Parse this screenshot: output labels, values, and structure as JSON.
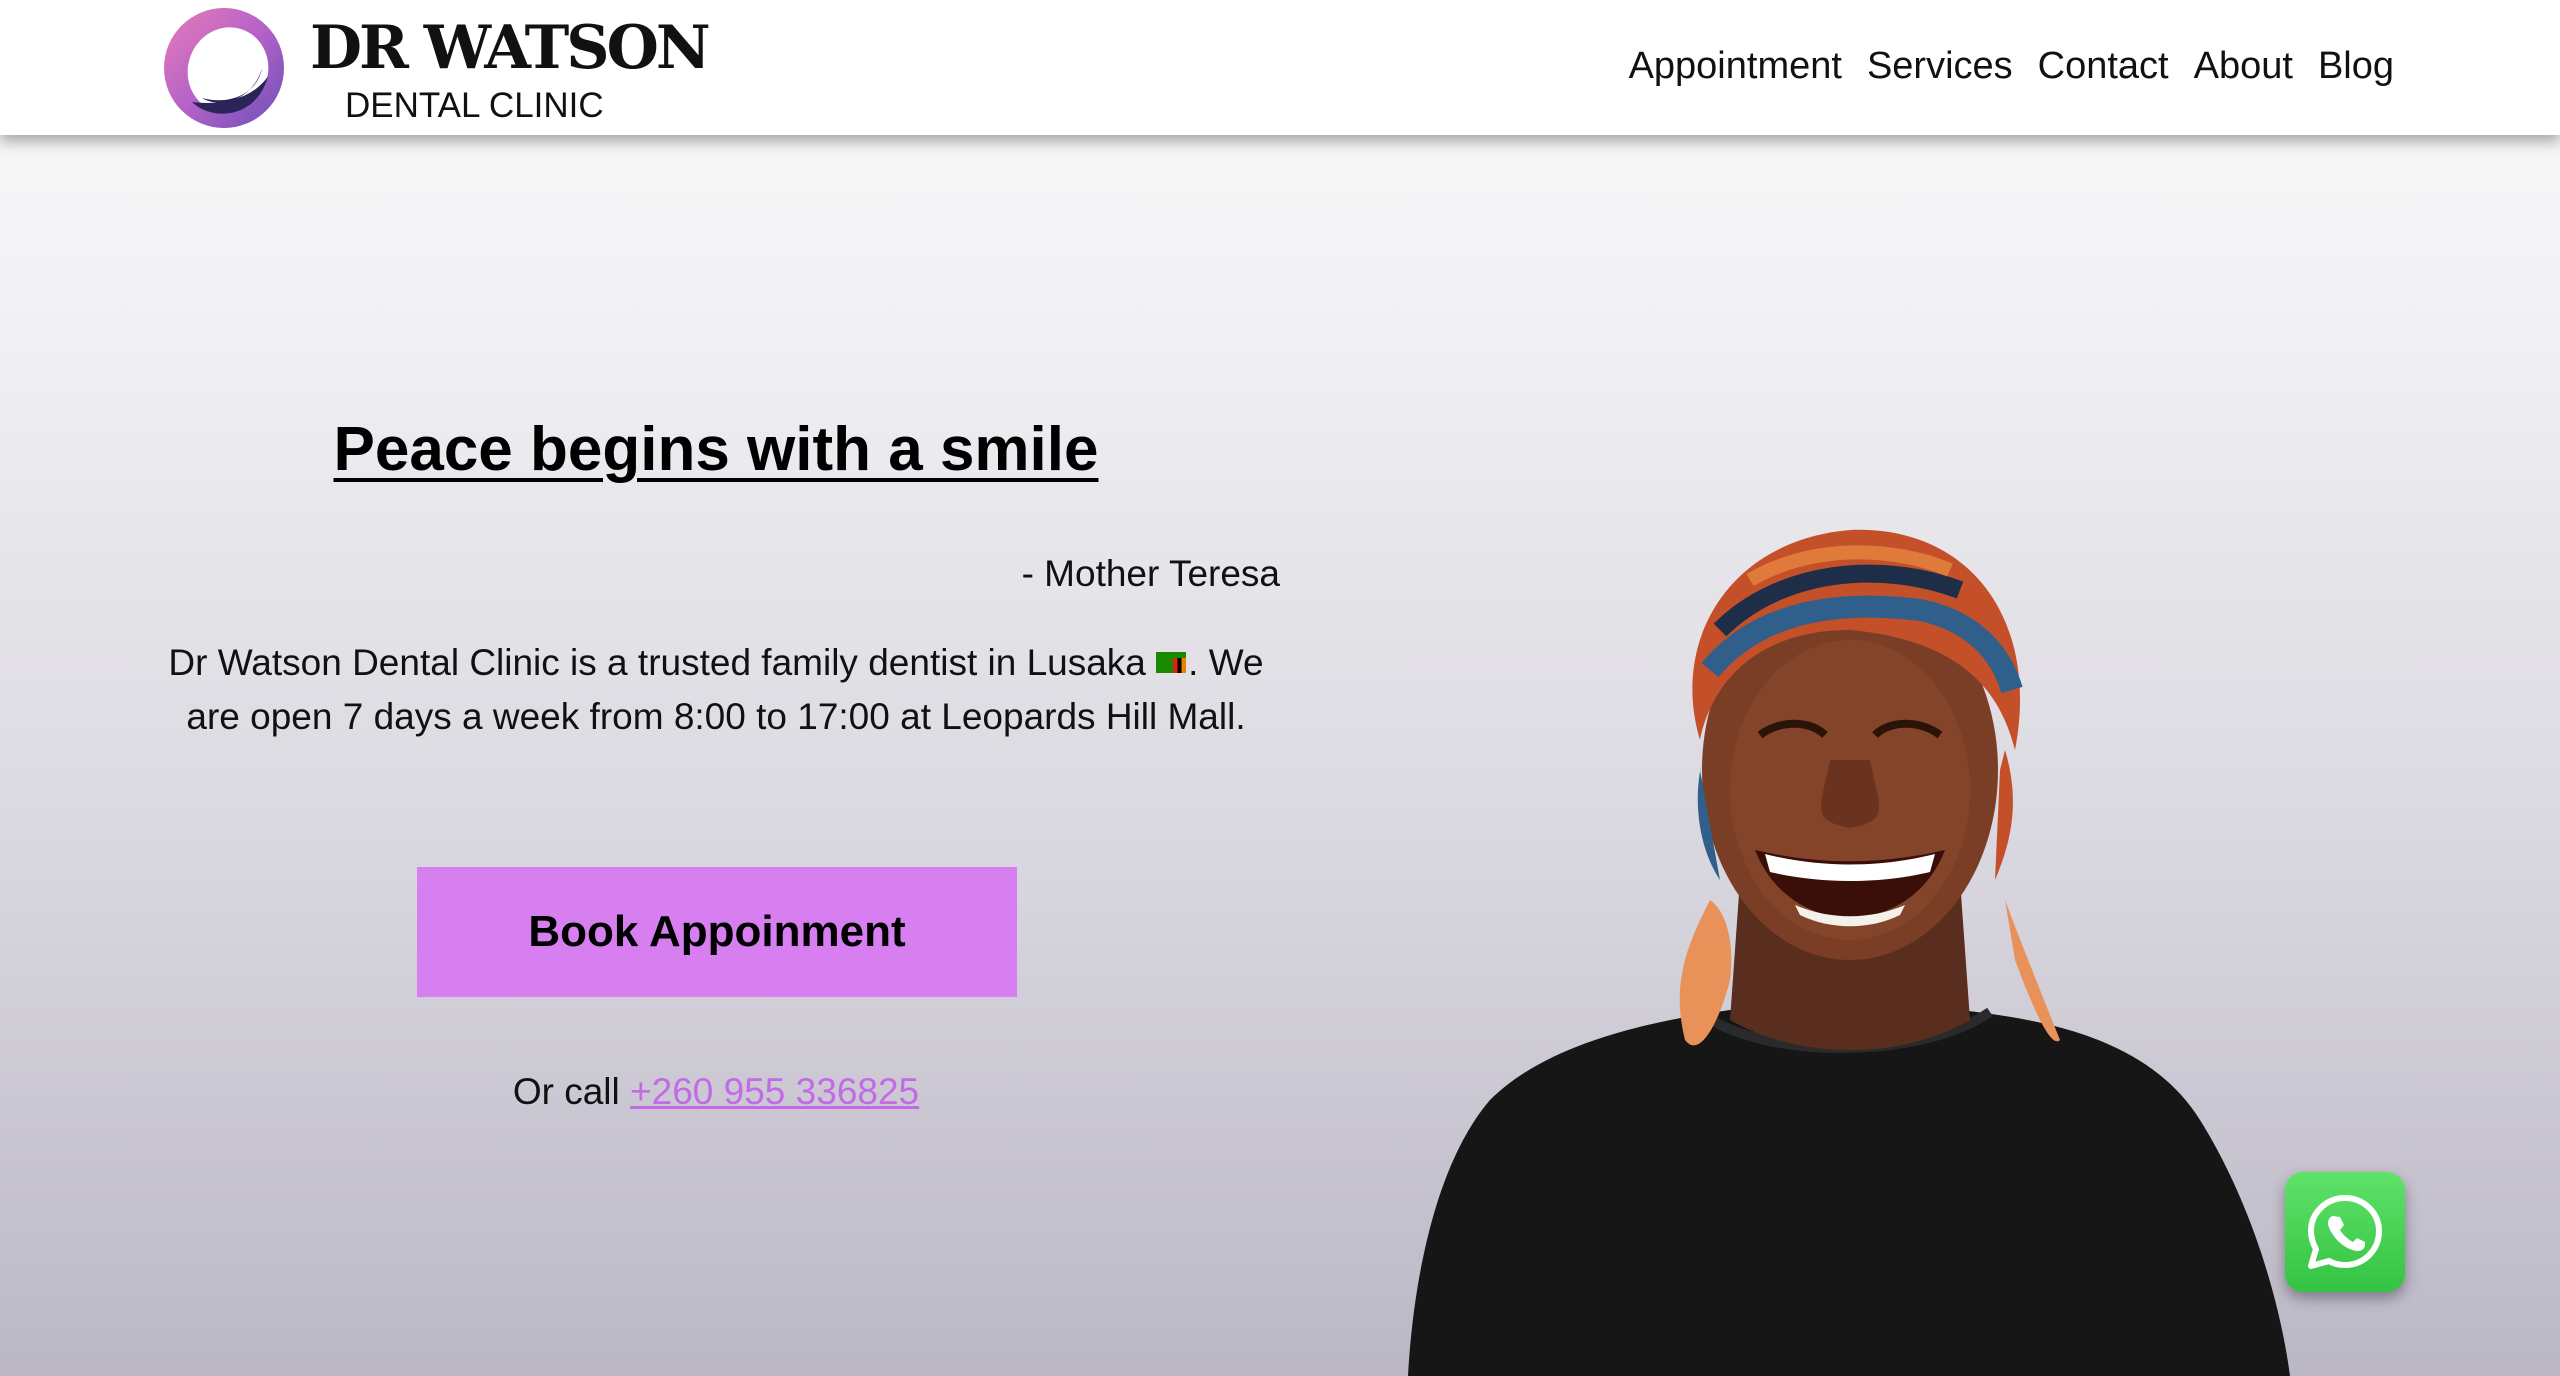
{
  "header": {
    "logo": {
      "title": "DR WATSON",
      "subtitle": "DENTAL CLINIC"
    },
    "nav": [
      "Appointment",
      "Services",
      "Contact",
      "About",
      "Blog"
    ]
  },
  "hero": {
    "heading": "Peace begins with a smile",
    "quote_author": "- Mother Teresa",
    "description_part1": "Dr Watson Dental Clinic is a trusted family dentist in Lusaka ",
    "flag_icon": "zambia-flag-icon",
    "description_part2": ". We are open 7 days a week from 8:00 to 17:00 at Leopards Hill Mall.",
    "button_label": "Book Appoinment",
    "call_prefix": "Or call ",
    "phone": "+260 955 336825"
  },
  "colors": {
    "accent": "#d77ff0",
    "link": "#c36be6",
    "whatsapp": "#40d14d"
  },
  "icons": {
    "whatsapp": "whatsapp-icon"
  }
}
